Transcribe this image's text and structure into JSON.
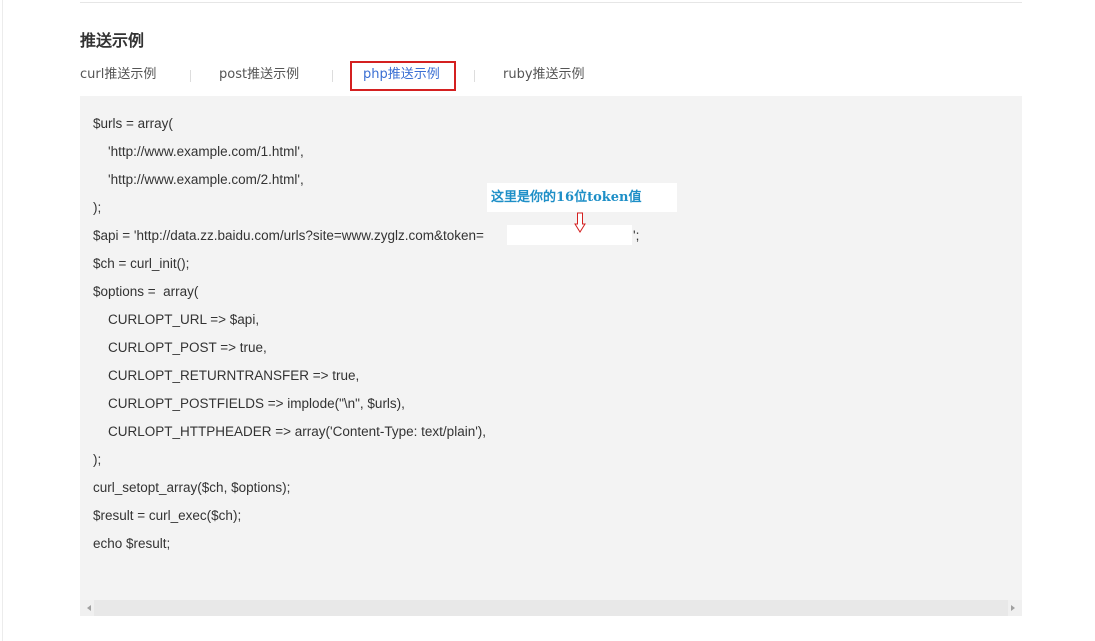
{
  "section": {
    "title": "推送示例"
  },
  "tabs": [
    {
      "label": "curl推送示例",
      "active": false
    },
    {
      "label": "post推送示例",
      "active": false
    },
    {
      "label": "php推送示例",
      "active": true
    },
    {
      "label": "ruby推送示例",
      "active": false
    }
  ],
  "code": {
    "lines": [
      "$urls = array(",
      "    'http://www.example.com/1.html',",
      "    'http://www.example.com/2.html',",
      ");",
      "$api = 'http://data.zz.baidu.com/urls?site=www.zyglz.com&token=",
      "$ch = curl_init();",
      "$options =  array(",
      "    CURLOPT_URL => $api,",
      "    CURLOPT_POST => true,",
      "    CURLOPT_RETURNTRANSFER => true,",
      "    CURLOPT_POSTFIELDS => implode(\"\\n\", $urls),",
      "    CURLOPT_HTTPHEADER => array('Content-Type: text/plain'),",
      ");",
      "curl_setopt_array($ch, $options);",
      "$result = curl_exec($ch);",
      "echo $result;"
    ],
    "api_line_suffix": "';"
  },
  "annotation": {
    "text": "这里是你的16位token值",
    "color": "#1e8fc7",
    "highlight_color": "#d42020"
  },
  "icons": {
    "annotation_arrow": "down-arrow-icon",
    "scroll_left": "scroll-left-icon",
    "scroll_right": "scroll-right-icon"
  }
}
